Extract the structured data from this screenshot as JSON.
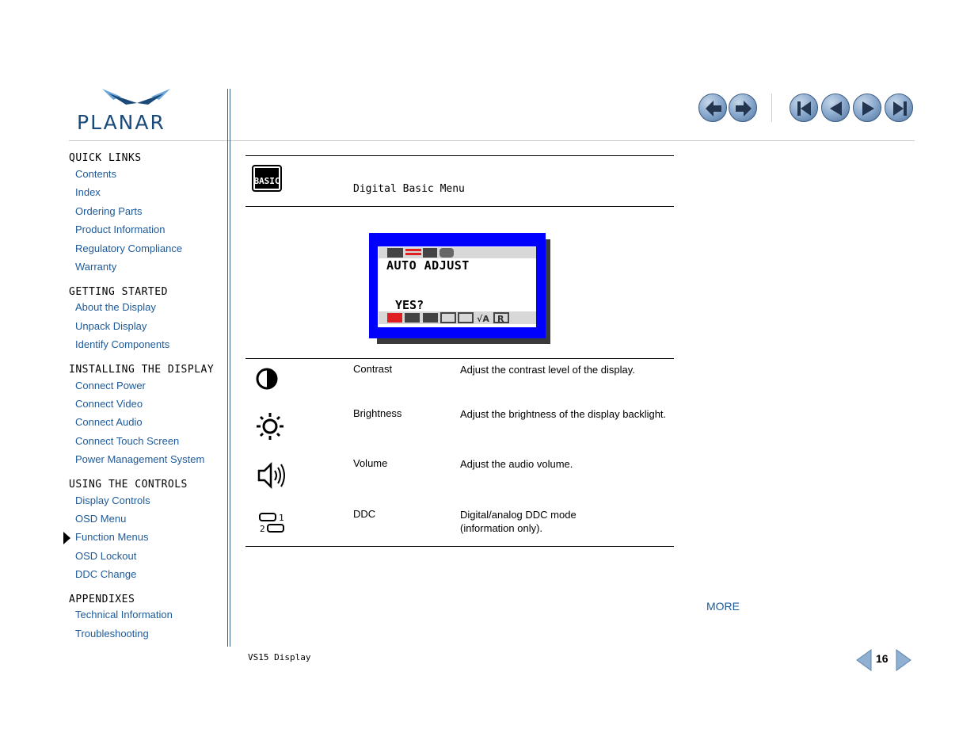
{
  "brand": {
    "name": "PLANAR"
  },
  "sidebar": {
    "sections": [
      {
        "heading": "QUICK LINKS",
        "links": [
          "Contents",
          "Index",
          "Ordering Parts",
          "Product Information",
          "Regulatory Compliance",
          "Warranty"
        ]
      },
      {
        "heading": "GETTING STARTED",
        "links": [
          "About the Display",
          "Unpack Display",
          "Identify Components"
        ]
      },
      {
        "heading": "INSTALLING THE DISPLAY",
        "links": [
          "Connect Power",
          "Connect Video",
          "Connect Audio",
          "Connect Touch Screen",
          "Power Management System"
        ]
      },
      {
        "heading": "USING THE CONTROLS",
        "links": [
          "Display Controls",
          "OSD Menu",
          "Function Menus",
          "OSD Lockout",
          "DDC Change"
        ]
      },
      {
        "heading": "APPENDIXES",
        "links": [
          "Technical Information",
          "Troubleshooting"
        ]
      }
    ],
    "current": "Function Menus"
  },
  "nav": {
    "buttons": [
      "back-icon",
      "forward-icon",
      "first-page-icon",
      "previous-page-icon",
      "next-page-icon",
      "last-page-icon"
    ]
  },
  "content": {
    "menu_icon_text": "BASIC",
    "menu_title": "Digital Basic Menu",
    "osd": {
      "line1": "AUTO ADJUST",
      "line2": "YES?",
      "frame_color": "#0000ff",
      "active_color": "#e02020"
    },
    "rows": [
      {
        "icon": "contrast-icon",
        "name": "Contrast",
        "desc": "Adjust the contrast level of the display."
      },
      {
        "icon": "brightness-icon",
        "name": "Brightness",
        "desc": "Adjust the brightness of the display backlight."
      },
      {
        "icon": "volume-icon",
        "name": "Volume",
        "desc": "Adjust the audio volume."
      },
      {
        "icon": "ddc-icon",
        "name": "DDC",
        "desc": "Digital/analog DDC mode (information only)."
      }
    ],
    "more_label": "MORE"
  },
  "footer": {
    "doc_title": "VS15 Display",
    "page_number": "16"
  },
  "colors": {
    "link": "#1e5a9a",
    "brand": "#1a4a7a",
    "divider": "#3a5f86"
  }
}
